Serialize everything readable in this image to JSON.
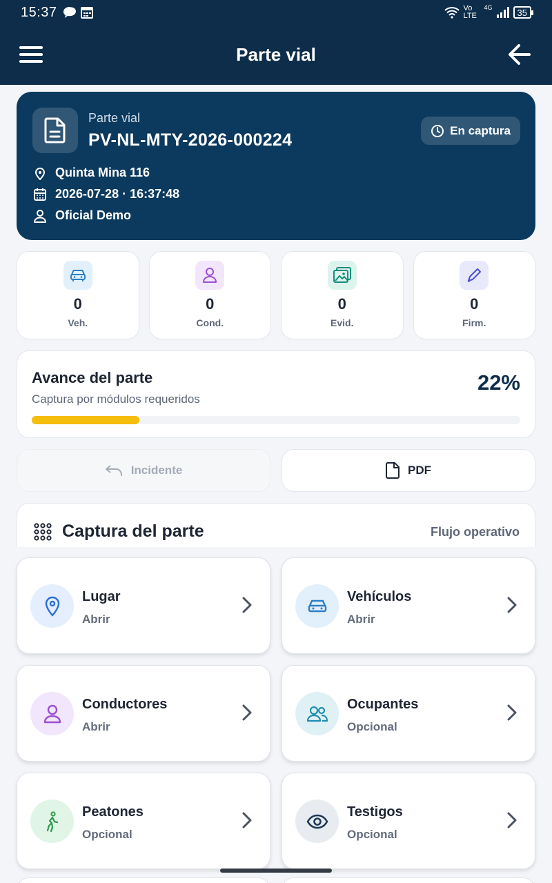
{
  "status_bar": {
    "time": "15:37",
    "network": "Vo LTE",
    "signal_badge": "4G",
    "battery": "35"
  },
  "app_bar": {
    "title": "Parte vial"
  },
  "header_card": {
    "kind": "Parte vial",
    "folio": "PV-NL-MTY-2026-000224",
    "status": "En captura",
    "location": "Quinta Mina 116",
    "datetime": "2026-07-28 · 16:37:48",
    "officer": "Oficial Demo"
  },
  "stats": [
    {
      "value": "0",
      "label": "Veh.",
      "icon": "car-icon"
    },
    {
      "value": "0",
      "label": "Cond.",
      "icon": "user-icon"
    },
    {
      "value": "0",
      "label": "Evid.",
      "icon": "image-icon"
    },
    {
      "value": "0",
      "label": "Firm.",
      "icon": "pencil-icon"
    }
  ],
  "progress": {
    "title": "Avance del parte",
    "subtitle": "Captura por módulos requeridos",
    "percent_label": "22%",
    "percent": 22,
    "color": "#f5bd0c"
  },
  "actions": {
    "incident": "Incidente",
    "pdf": "PDF"
  },
  "section": {
    "title": "Captura del parte",
    "link": "Flujo operativo"
  },
  "modules": [
    {
      "name": "Lugar",
      "status": "Abrir",
      "icon": "location-pin-icon"
    },
    {
      "name": "Vehículos",
      "status": "Abrir",
      "icon": "car-icon"
    },
    {
      "name": "Conductores",
      "status": "Abrir",
      "icon": "user-icon"
    },
    {
      "name": "Ocupantes",
      "status": "Opcional",
      "icon": "users-icon"
    },
    {
      "name": "Peatones",
      "status": "Opcional",
      "icon": "pedestrian-icon"
    },
    {
      "name": "Testigos",
      "status": "Opcional",
      "icon": "eye-icon"
    }
  ],
  "colors": {
    "primary": "#0d2d4a",
    "hero": "#0c3a5e",
    "accent": "#f5bd0c"
  }
}
